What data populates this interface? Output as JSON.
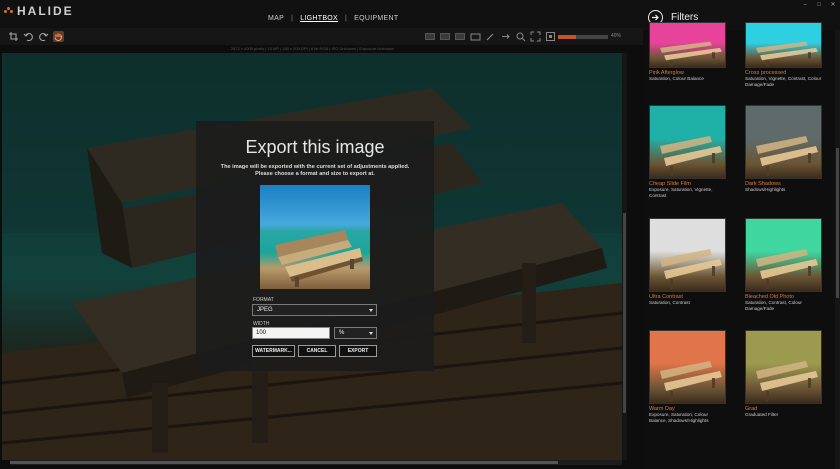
{
  "app": {
    "logo": "HALIDE"
  },
  "nav": {
    "items": [
      "MAP",
      "LIGHTBOX",
      "EQUIPMENT"
    ],
    "separator": "|",
    "active": "LIGHTBOX"
  },
  "toolbar": {
    "zoom_percent": 35,
    "zoom_label": "40%"
  },
  "info": {
    "text": "2672 x 4000 pixels | 10 MP | 180 x 200 DPI | 8 bit RGB | ISO Unknown | Exposure Unknown"
  },
  "dialog": {
    "title": "Export this image",
    "description_line1": "The image will be exported with the current set of adjustments applied.",
    "description_line2": "Please choose a format and size to export at.",
    "format_label": "FORMAT",
    "format_value": "JPEG",
    "width_label": "WIDTH",
    "width_value": "100",
    "unit_value": "%",
    "watermark_button": "WATERMARK...",
    "cancel_button": "CANCEL",
    "export_button": "EXPORT"
  },
  "panel": {
    "title": "Filters",
    "window_buttons": [
      "–",
      "□",
      "✕"
    ],
    "filters": [
      {
        "name": "Pink Afterglow",
        "adjustments": "Saturation, Colour Balance",
        "tint": "#e8439a"
      },
      {
        "name": "Cross processed",
        "adjustments": "Saturation, Vignette, Contrast, Colour Damage/Fade",
        "tint": "#2ecfe0"
      },
      {
        "name": "Cheap Slide Film",
        "adjustments": "Exposure, Saturation, Vignette, Contrast",
        "tint": "#1fb1a8"
      },
      {
        "name": "Dark Shadows",
        "adjustments": "Shadows/Highlights",
        "tint": "#5f6b6b"
      },
      {
        "name": "Ultra Contrast",
        "adjustments": "Saturation, Contrast",
        "tint": "#dedede"
      },
      {
        "name": "Bleached Old Photo",
        "adjustments": "Saturation, Contrast, Colour Damage/Fade",
        "tint": "#3fd6a0"
      },
      {
        "name": "Warm Day",
        "adjustments": "Exposure, Saturation, Colour Balance, Shadows/Highlights",
        "tint": "#e0744a"
      },
      {
        "name": "Grad",
        "adjustments": "Graduated Filter",
        "tint": "#9c9a4e"
      }
    ]
  }
}
